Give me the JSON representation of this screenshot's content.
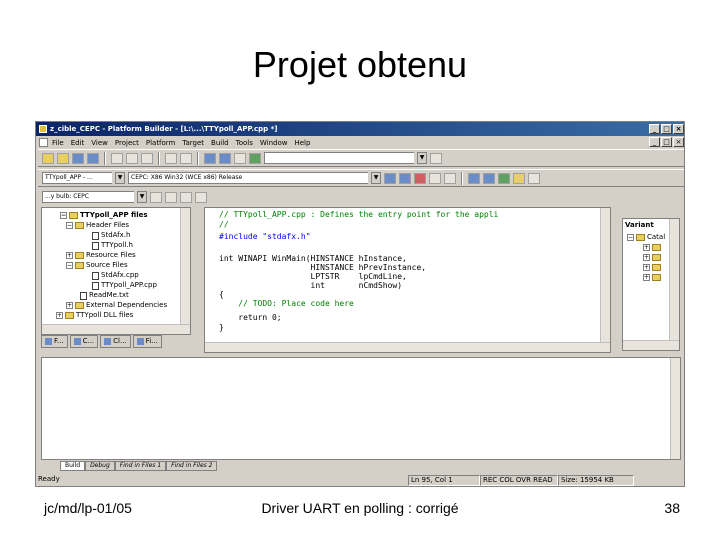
{
  "slide": {
    "title": "Projet obtenu",
    "footer_left": "jc/md/lp-01/05",
    "footer_center": "Driver UART en polling : corrigé",
    "page_number": "38"
  },
  "window": {
    "title": "z_cible_CEPC - Platform Builder - [L:\\...\\TTYpoll_APP.cpp *]",
    "minimize": "_",
    "maximize": "□",
    "close": "×"
  },
  "menu": [
    "File",
    "Edit",
    "View",
    "Project",
    "Platform",
    "Target",
    "Build",
    "Tools",
    "Window",
    "Help"
  ],
  "toolbar": {
    "project_combo": "TTYpoll_APP - ...",
    "config_combo": "CEPC: X86 Win32 (WCE x86) Release",
    "target_combo": "...y bulb: CEPC"
  },
  "workspace": {
    "root": "TTYpoll_APP files",
    "items": [
      {
        "label": "Header Files",
        "type": "folder"
      },
      {
        "label": "StdAfx.h",
        "type": "file"
      },
      {
        "label": "TTYpoll.h",
        "type": "file"
      },
      {
        "label": "Resource Files",
        "type": "folder"
      },
      {
        "label": "Source Files",
        "type": "folder"
      },
      {
        "label": "StdAfx.cpp",
        "type": "file"
      },
      {
        "label": "TTYpoll_APP.cpp",
        "type": "file"
      },
      {
        "label": "ReadMe.txt",
        "type": "file"
      },
      {
        "label": "External Dependencies",
        "type": "folder"
      },
      {
        "label": "TTYpoll DLL files",
        "type": "folder"
      }
    ],
    "tabs": [
      "F...",
      "C...",
      "Cl...",
      "Fi..."
    ]
  },
  "editor": {
    "lines": [
      {
        "text": "// TTYpoll_APP.cpp : Defines the entry point for the appli",
        "kind": "comment"
      },
      {
        "text": "//",
        "kind": "comment"
      },
      {
        "text": "",
        "kind": "normal"
      },
      {
        "text": "#include \"stdafx.h\"",
        "kind": "kw"
      },
      {
        "text": "",
        "kind": "normal"
      },
      {
        "text": "int WINAPI WinMain(HINSTANCE hInstance,",
        "kind": "normal"
      },
      {
        "text": "                   HINSTANCE hPrevInstance,",
        "kind": "normal"
      },
      {
        "text": "                   LPTSTR    lpCmdLine,",
        "kind": "normal"
      },
      {
        "text": "                   int       nCmdShow)",
        "kind": "normal"
      },
      {
        "text": "{",
        "kind": "normal"
      },
      {
        "text": "    // TODO: Place code here",
        "kind": "comment"
      },
      {
        "text": "",
        "kind": "normal"
      },
      {
        "text": "    return 0;",
        "kind": "normal"
      },
      {
        "text": "}",
        "kind": "normal"
      }
    ]
  },
  "properties": {
    "header": "Variant",
    "root": "Catal"
  },
  "output_tabs": [
    "Build",
    "Debug",
    "Find in Files 1",
    "Find in Files 2"
  ],
  "status": {
    "ready": "Ready",
    "position": "Ln 95, Col 1",
    "flags": "REC COL OVR READ",
    "size": "Size: 15954 KB"
  }
}
